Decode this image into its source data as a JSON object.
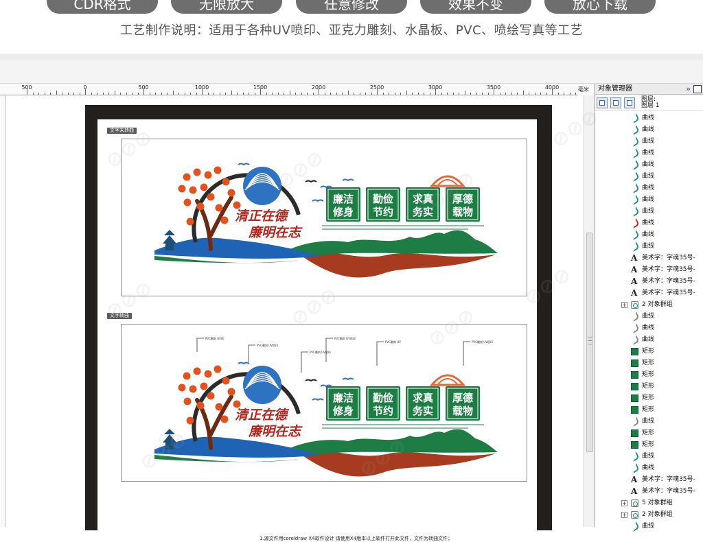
{
  "banner": {
    "pills": [
      "CDR格式",
      "无限放大",
      "任意修改",
      "效果不变",
      "放心下载"
    ],
    "note": "工艺制作说明：适用于各种UV喷印、亚克力雕刻、水晶板、PVC、喷绘写真等工艺"
  },
  "ruler": {
    "labels": [
      "500",
      "0",
      "500",
      "1000",
      "1500",
      "2000",
      "2500",
      "3000",
      "3500",
      "4000"
    ],
    "unit": "毫米"
  },
  "document": {
    "tag_top": "文字未转曲",
    "tag_bottom": "文字转曲",
    "slogan_line1": "清正在德",
    "slogan_line2": "廉明在志",
    "panels": [
      {
        "line1": "廉洁",
        "line2": "修身"
      },
      {
        "line1": "勤俭",
        "line2": "节约"
      },
      {
        "line1": "求真",
        "line2": "务实"
      },
      {
        "line1": "厚德",
        "line2": "载物"
      }
    ],
    "callouts": [
      "PVC雕刻 UV喷",
      "PVC雕刻 UV喷印",
      "PVC雕刻 UV喷印",
      "PVC雕刻 UV喷印",
      "PVC雕刻 UV",
      "PVC雕刻 UV喷印"
    ],
    "footnote": "1.源文件用coreldraw X4软件设计  请使用X4版本以上软件打开此文件，文件为转曲文件；"
  },
  "panel": {
    "title": "对象管理器",
    "expand_glyph": "»",
    "layer_line1": "图层:",
    "layer_line2": "图层 1",
    "items": [
      {
        "icon": "curve",
        "label": "曲线"
      },
      {
        "icon": "curve",
        "label": "曲线"
      },
      {
        "icon": "curve",
        "label": "曲线"
      },
      {
        "icon": "curve",
        "label": "曲线"
      },
      {
        "icon": "curve",
        "label": "曲线"
      },
      {
        "icon": "curve",
        "label": "曲线"
      },
      {
        "icon": "curve",
        "label": "曲线"
      },
      {
        "icon": "curve",
        "label": "曲线"
      },
      {
        "icon": "curve",
        "label": "曲线"
      },
      {
        "icon": "curve-red",
        "label": "曲线"
      },
      {
        "icon": "curve",
        "label": "曲线"
      },
      {
        "icon": "curve",
        "label": "曲线"
      },
      {
        "icon": "text",
        "label": "美术字：字魂35号-"
      },
      {
        "icon": "text",
        "label": "美术字：字魂35号-"
      },
      {
        "icon": "text",
        "label": "美术字：字魂35号-"
      },
      {
        "icon": "text",
        "label": "美术字：字魂35号-"
      },
      {
        "icon": "group",
        "label": "2 对象群组",
        "expander": "+"
      },
      {
        "icon": "curve-white",
        "label": "曲线"
      },
      {
        "icon": "curve-white",
        "label": "曲线"
      },
      {
        "icon": "curve-white",
        "label": "曲线"
      },
      {
        "icon": "rect",
        "label": "矩形"
      },
      {
        "icon": "rect",
        "label": "矩形"
      },
      {
        "icon": "rect",
        "label": "矩形"
      },
      {
        "icon": "rect",
        "label": "矩形"
      },
      {
        "icon": "rect",
        "label": "矩形"
      },
      {
        "icon": "rect",
        "label": "矩形"
      },
      {
        "icon": "curve-white",
        "label": "曲线"
      },
      {
        "icon": "rect",
        "label": "矩形"
      },
      {
        "icon": "rect",
        "label": "矩形"
      },
      {
        "icon": "curve",
        "label": "曲线"
      },
      {
        "icon": "curve",
        "label": "曲线"
      },
      {
        "icon": "text",
        "label": "美术字：字魂35号-"
      },
      {
        "icon": "text",
        "label": "美术字：字魂35号-"
      },
      {
        "icon": "group",
        "label": "5 对象群组",
        "expander": "+"
      },
      {
        "icon": "group",
        "label": "2 对象群组",
        "expander": "+"
      },
      {
        "icon": "curve",
        "label": "曲线"
      }
    ]
  },
  "colors": {
    "green": "#1e7d45",
    "red_brown": "#a63b1f",
    "blue": "#1f63b5",
    "slogan_red": "#b3261e",
    "frame": "#231f1c"
  }
}
